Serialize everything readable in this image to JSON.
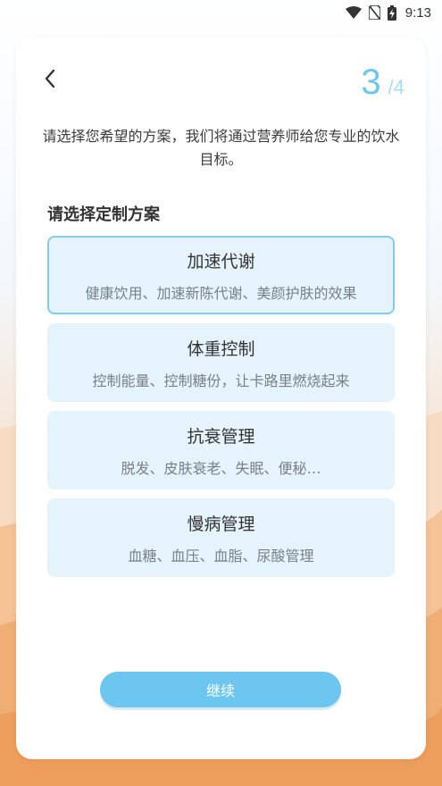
{
  "status_bar": {
    "time": "9:13",
    "icons": [
      "wifi-icon",
      "no-sim-icon",
      "battery-charging-icon"
    ]
  },
  "header": {
    "back_icon": "chevron-left-icon",
    "step_current": "3",
    "step_separator": "/",
    "step_total": "4"
  },
  "intro_text": "请选择您希望的方案，我们将通过营养师给您专业的饮水目标。",
  "section_title": "请选择定制方案",
  "options": [
    {
      "title": "加速代谢",
      "desc": "健康饮用、加速新陈代谢、美颜护肤的效果",
      "selected": true
    },
    {
      "title": "体重控制",
      "desc": "控制能量、控制糖份，让卡路里燃烧起来",
      "selected": false
    },
    {
      "title": "抗衰管理",
      "desc": "脱发、皮肤衰老、失眠、便秘…",
      "selected": false
    },
    {
      "title": "慢病管理",
      "desc": "血糖、血压、血脂、尿酸管理",
      "selected": false
    }
  ],
  "continue_label": "继续",
  "colors": {
    "accent": "#6cc6ef",
    "option_bg": "#e4f3fc",
    "selected_border": "#7dcdf0"
  }
}
